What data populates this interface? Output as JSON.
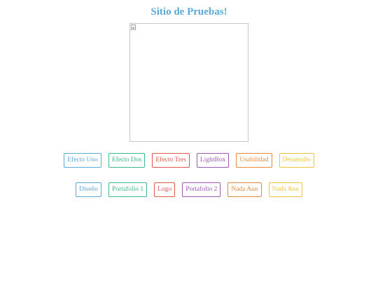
{
  "page": {
    "title": "Sitio de Pruebas!"
  },
  "image": {
    "icon": "broken-image-icon"
  },
  "buttons_row1": [
    {
      "label": "Efecto Uno",
      "color": "#5aa9d9"
    },
    {
      "label": "Efecto Dos",
      "color": "#3cb98a"
    },
    {
      "label": "Efecto Tres",
      "color": "#e0574e"
    },
    {
      "label": "LightBox",
      "color": "#9b59b6"
    },
    {
      "label": "Usabilidad",
      "color": "#e58a3a"
    },
    {
      "label": "Desarrollo",
      "color": "#f0c33c"
    }
  ],
  "buttons_row2": [
    {
      "label": "Diseño",
      "color": "#5aa9d9"
    },
    {
      "label": "Portafolio 1",
      "color": "#3cb98a"
    },
    {
      "label": "Logo",
      "color": "#e0574e"
    },
    {
      "label": "Portafolio 2",
      "color": "#9b59b6"
    },
    {
      "label": "Nada Aun",
      "color": "#e58a3a"
    },
    {
      "label": "Nada Aun",
      "color": "#f0c33c"
    }
  ]
}
